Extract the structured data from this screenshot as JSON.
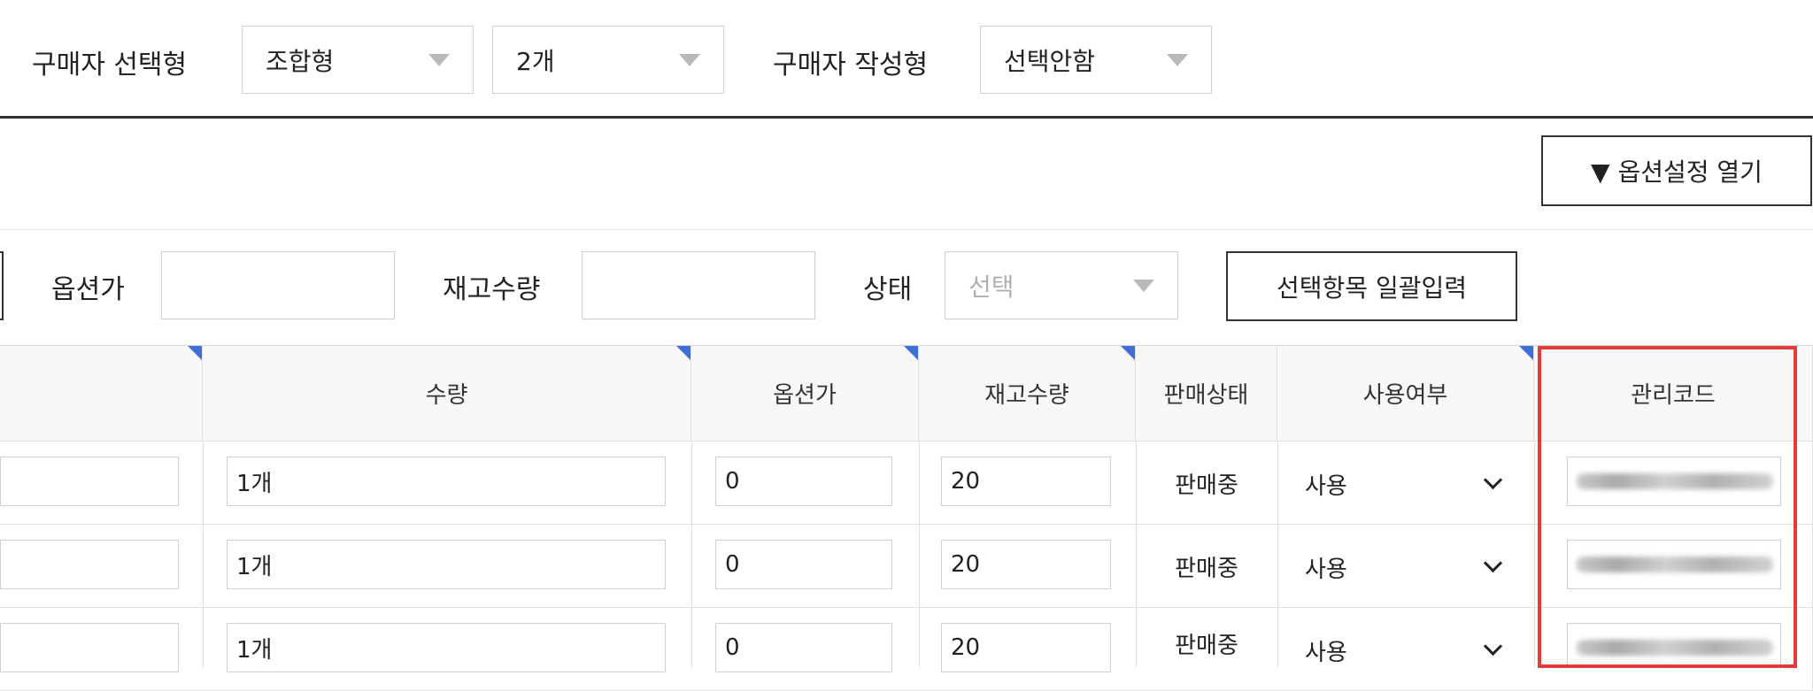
{
  "buyer_select": {
    "label": "구매자 선택형",
    "type_value": "조합형",
    "count_value": "2개"
  },
  "buyer_write": {
    "label": "구매자 작성형",
    "value": "선택안함"
  },
  "option_settings_button": "▼ 옵션설정 열기",
  "bulk_form": {
    "price_label": "옵션가",
    "price_value": "",
    "stock_label": "재고수량",
    "stock_value": "",
    "status_label": "상태",
    "status_placeholder": "선택",
    "apply_button": "선택항목 일괄입력"
  },
  "table": {
    "headers": [
      "수량",
      "옵션가",
      "재고수량",
      "판매상태",
      "사용여부",
      "관리코드"
    ],
    "rows": [
      {
        "qty": "1개",
        "price": "0",
        "stock": "20",
        "status": "판매중",
        "use": "사용"
      },
      {
        "qty": "1개",
        "price": "0",
        "stock": "20",
        "status": "판매중",
        "use": "사용"
      },
      {
        "qty": "1개",
        "price": "0",
        "stock": "20",
        "status": "판매중",
        "use": "사용"
      }
    ]
  },
  "colors": {
    "highlight": "#e53b3b",
    "header_marker": "#3d6fd6"
  }
}
